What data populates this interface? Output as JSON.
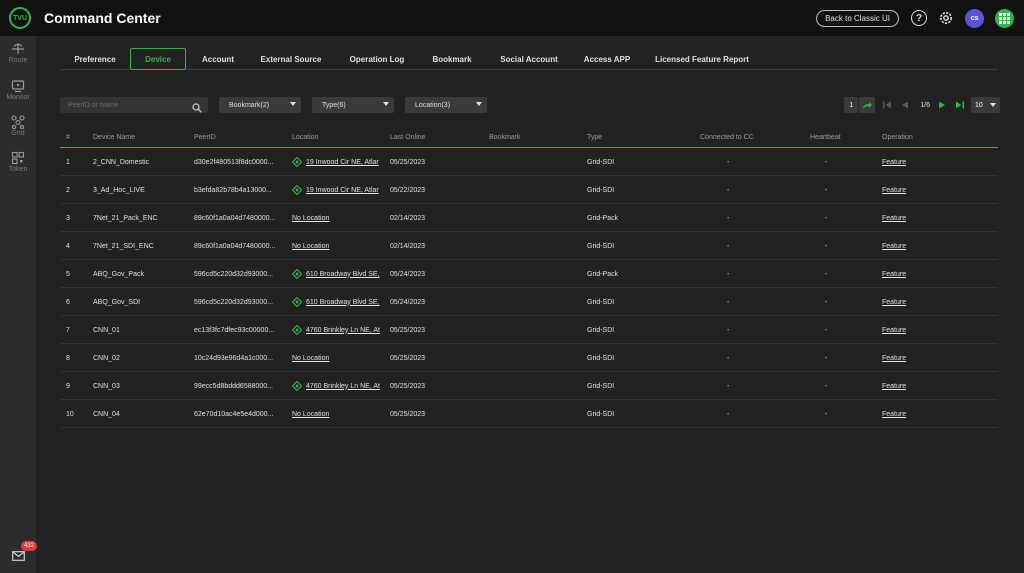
{
  "header": {
    "logo_text": "TVU",
    "title": "Command Center",
    "classic_label": "Back to Classic UI",
    "help_glyph": "?",
    "avatar_initials": "cs"
  },
  "sidebar": {
    "items": [
      {
        "label": "Route",
        "icon": "route-icon"
      },
      {
        "label": "Monitor",
        "icon": "monitor-icon"
      },
      {
        "label": "Grid",
        "icon": "grid-icon"
      },
      {
        "label": "Token",
        "icon": "token-icon"
      }
    ],
    "mail_badge": "432"
  },
  "tabs": [
    {
      "label": "Preference",
      "active": false
    },
    {
      "label": "Device",
      "active": true
    },
    {
      "label": "Account",
      "active": false
    },
    {
      "label": "External Source",
      "active": false
    },
    {
      "label": "Operation Log",
      "active": false
    },
    {
      "label": "Bookmark",
      "active": false
    },
    {
      "label": "Social Account",
      "active": false
    },
    {
      "label": "Access APP",
      "active": false
    },
    {
      "label": "Licensed Feature Report",
      "active": false
    }
  ],
  "filters": {
    "search_placeholder": "PeerID or Name",
    "bookmark": "Bookmark(2)",
    "type": "Type(6)",
    "location": "Location(3)"
  },
  "pager": {
    "current_page": "1",
    "page_info": "1/6",
    "per_page": "10"
  },
  "table": {
    "columns": [
      "#",
      "Device Name",
      "PeerID",
      "Location",
      "Last Online",
      "Bookmark",
      "Type",
      "Connected to CC",
      "Heartbeat",
      "Operation"
    ],
    "rows": [
      {
        "n": "1",
        "name": "2_CNN_Domestic",
        "peer": "d30e2f480513f8dc0000...",
        "location": "19 Inwood Cir NE, Atlar",
        "has_loc": true,
        "last": "05/25/2023",
        "bookmark": "",
        "type": "Grid-SDI",
        "cc": "-",
        "hb": "-",
        "op": "Feature"
      },
      {
        "n": "2",
        "name": "3_Ad_Hoc_LIVE",
        "peer": "b3efda82b78b4a13000...",
        "location": "19 Inwood Cir NE, Atlar",
        "has_loc": true,
        "last": "05/22/2023",
        "bookmark": "",
        "type": "Grid-SDI",
        "cc": "-",
        "hb": "-",
        "op": "Feature"
      },
      {
        "n": "3",
        "name": "7Net_21_Pack_ENC",
        "peer": "89c60f1a0a04d7480000...",
        "location": "No Location",
        "has_loc": false,
        "last": "02/14/2023",
        "bookmark": "",
        "type": "Grid-Pack",
        "cc": "-",
        "hb": "-",
        "op": "Feature"
      },
      {
        "n": "4",
        "name": "7Net_21_SDI_ENC",
        "peer": "89c60f1a0a04d7480000...",
        "location": "No Location",
        "has_loc": false,
        "last": "02/14/2023",
        "bookmark": "",
        "type": "Grid-SDI",
        "cc": "-",
        "hb": "-",
        "op": "Feature"
      },
      {
        "n": "5",
        "name": "ABQ_Gov_Pack",
        "peer": "596cd5c220d32d93000...",
        "location": "610 Broadway Blvd SE,",
        "has_loc": true,
        "last": "05/24/2023",
        "bookmark": "",
        "type": "Grid-Pack",
        "cc": "-",
        "hb": "-",
        "op": "Feature"
      },
      {
        "n": "6",
        "name": "ABQ_Gov_SDI",
        "peer": "596cd5c220d32d93000...",
        "location": "610 Broadway Blvd SE,",
        "has_loc": true,
        "last": "05/24/2023",
        "bookmark": "",
        "type": "Grid-SDI",
        "cc": "-",
        "hb": "-",
        "op": "Feature"
      },
      {
        "n": "7",
        "name": "CNN_01",
        "peer": "ec13f3fc7dfec93c00000...",
        "location": "4760 Brinkley Ln NE, At",
        "has_loc": true,
        "last": "05/25/2023",
        "bookmark": "",
        "type": "Grid-SDI",
        "cc": "-",
        "hb": "-",
        "op": "Feature"
      },
      {
        "n": "8",
        "name": "CNN_02",
        "peer": "10c24d93e96d4a1c000...",
        "location": "No Location",
        "has_loc": false,
        "last": "05/25/2023",
        "bookmark": "",
        "type": "Grid-SDI",
        "cc": "-",
        "hb": "-",
        "op": "Feature"
      },
      {
        "n": "9",
        "name": "CNN_03",
        "peer": "99ecc5d8bddd6588000...",
        "location": "4760 Brinkley Ln NE, At",
        "has_loc": true,
        "last": "05/25/2023",
        "bookmark": "",
        "type": "Grid-SDI",
        "cc": "-",
        "hb": "-",
        "op": "Feature"
      },
      {
        "n": "10",
        "name": "CNN_04",
        "peer": "62e70d10ac4e5e4d000...",
        "location": "No Location",
        "has_loc": false,
        "last": "05/25/2023",
        "bookmark": "",
        "type": "Grid-SDI",
        "cc": "-",
        "hb": "-",
        "op": "Feature"
      }
    ]
  },
  "colors": {
    "accent": "#33b44a",
    "background": "#222222",
    "topbar": "#111111",
    "avatar": "#5856d6"
  }
}
